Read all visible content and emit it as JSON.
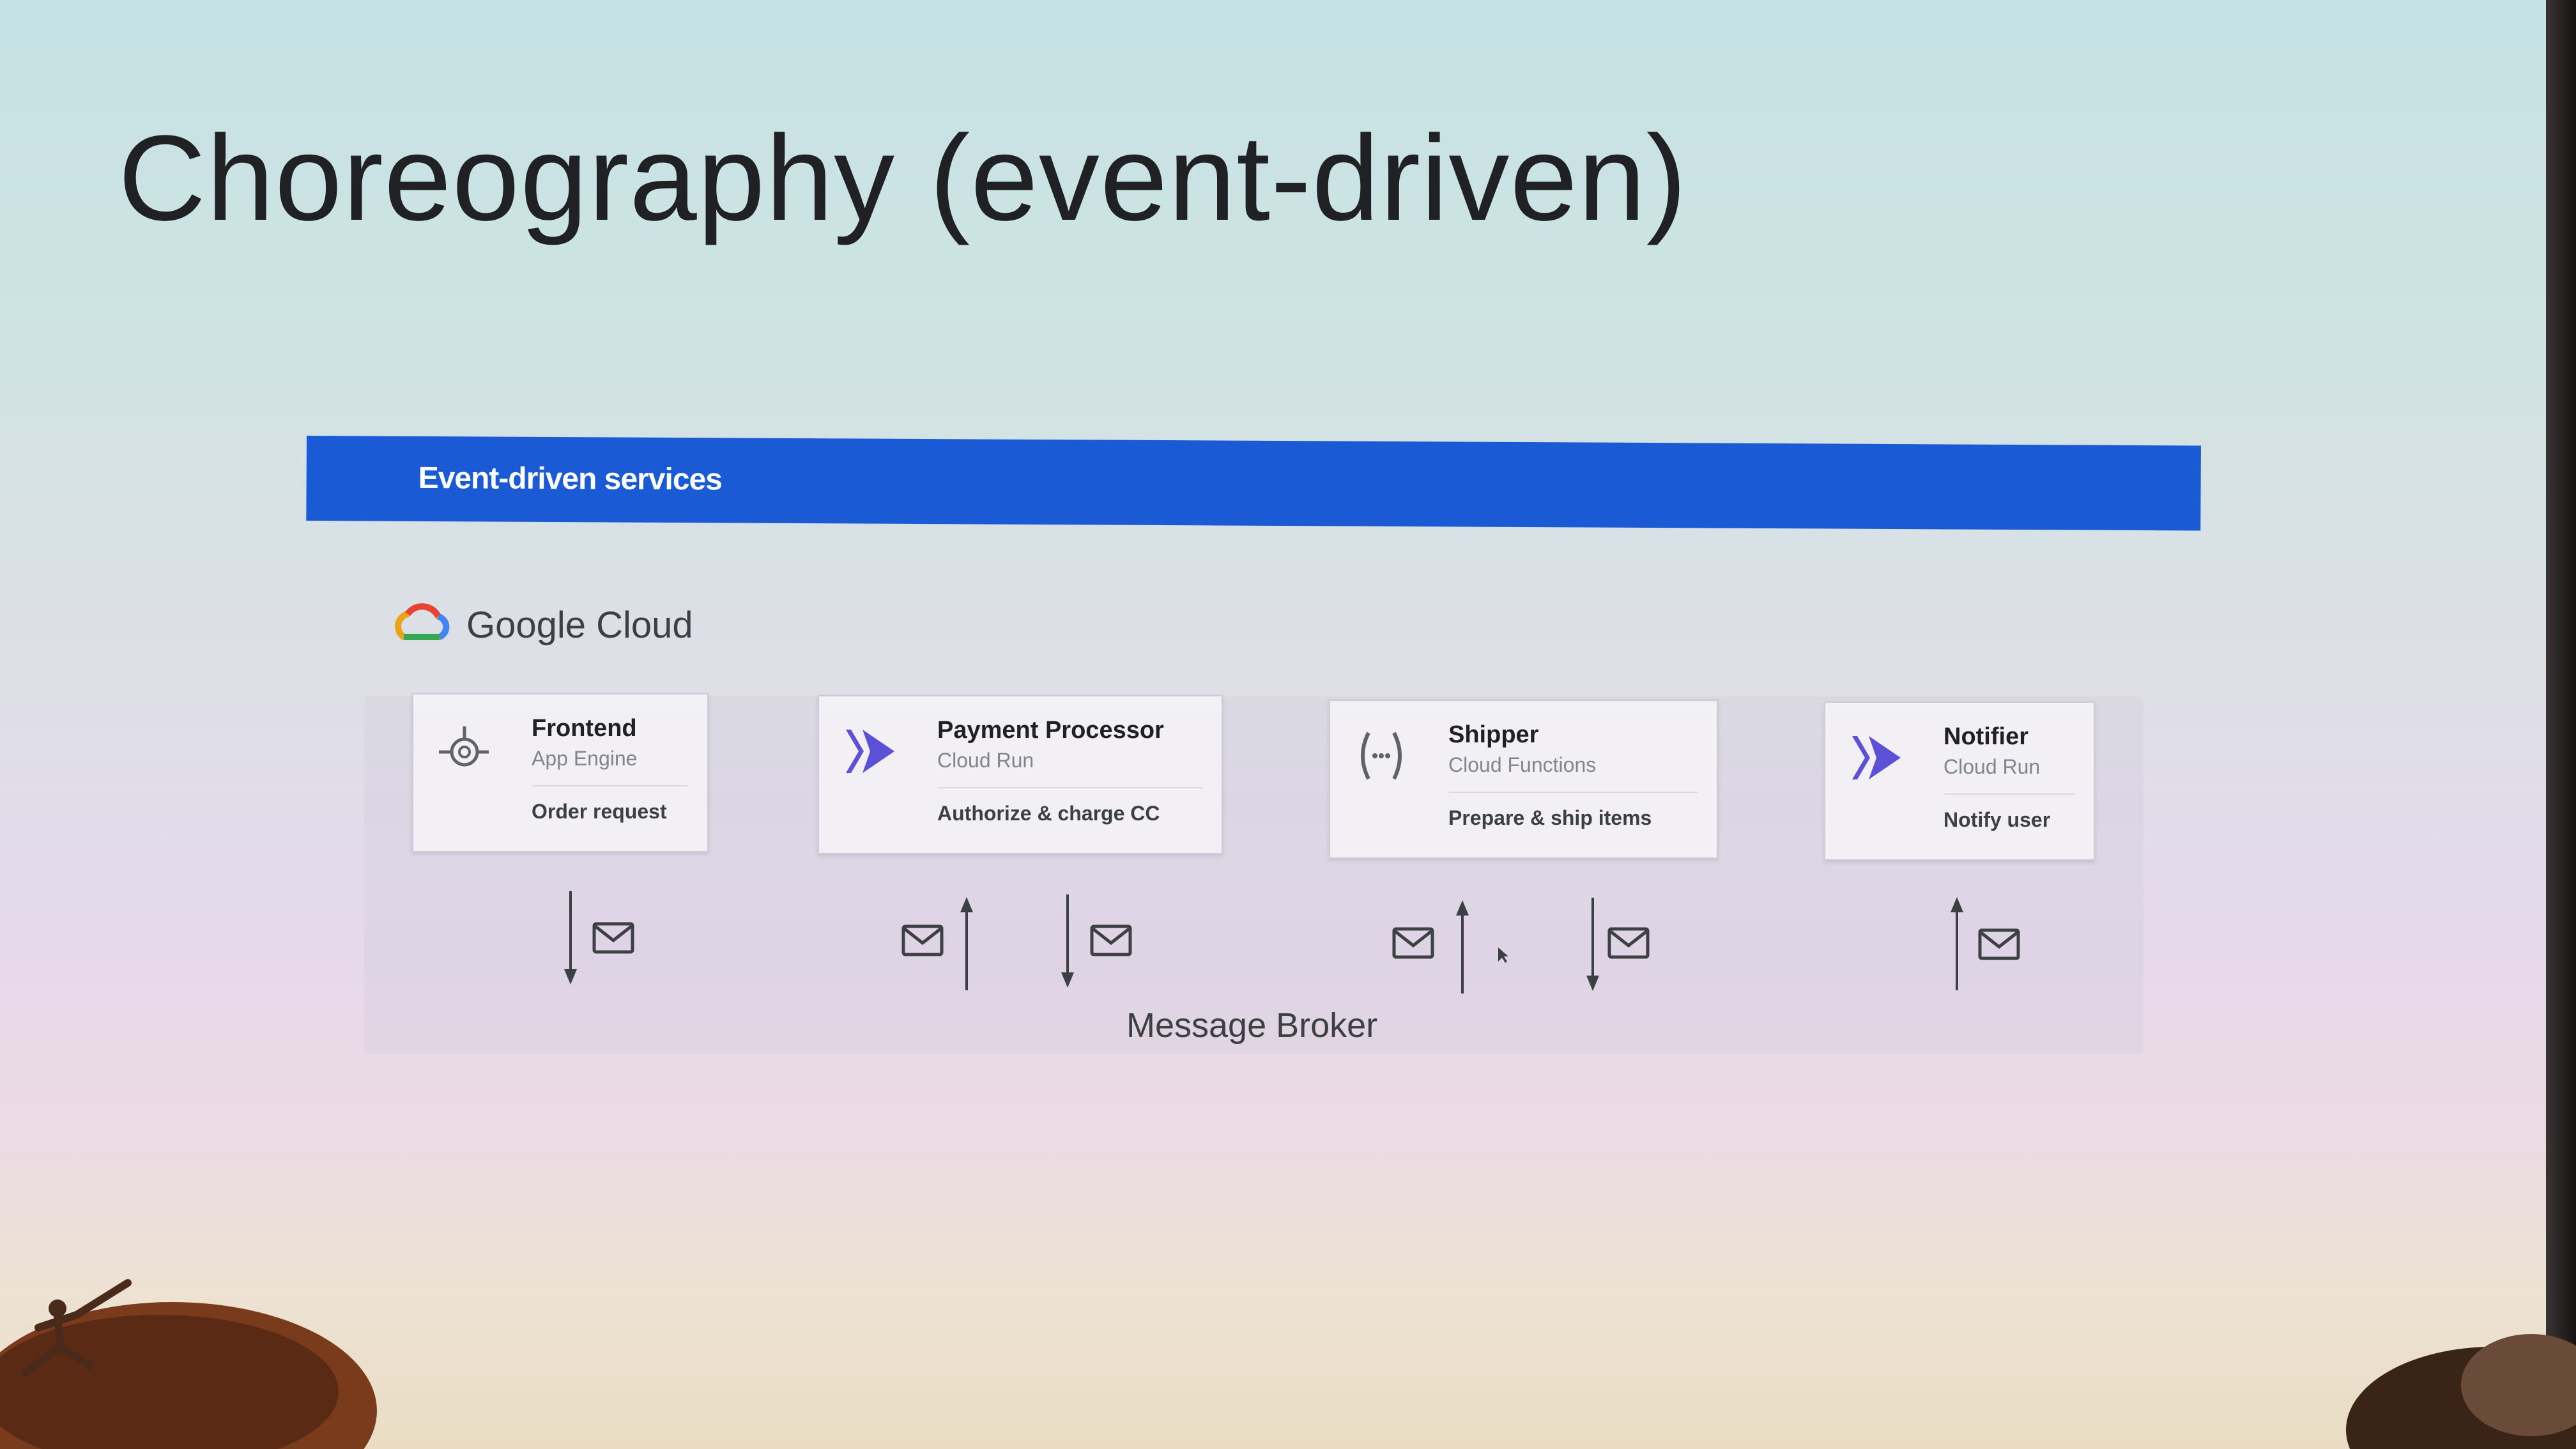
{
  "title": "Choreography (event-driven)",
  "banner": {
    "label": "Event-driven services",
    "color": "#1a5ad4"
  },
  "provider": {
    "name": "Google Cloud",
    "icon": "google-cloud-logo-icon"
  },
  "services": [
    {
      "name": "Frontend",
      "service": "App Engine",
      "action": "Order request",
      "icon": "app-engine-icon"
    },
    {
      "name": "Payment Processor",
      "service": "Cloud Run",
      "action": "Authorize & charge CC",
      "icon": "cloud-run-icon"
    },
    {
      "name": "Shipper",
      "service": "Cloud Functions",
      "action": "Prepare & ship items",
      "icon": "cloud-functions-icon"
    },
    {
      "name": "Notifier",
      "service": "Cloud Run",
      "action": "Notify user",
      "icon": "cloud-run-icon"
    }
  ],
  "broker": {
    "label": "Message Broker"
  },
  "colors": {
    "run_icon": "#5c50d6",
    "text_dark": "#202124",
    "text_muted": "#80868b"
  }
}
